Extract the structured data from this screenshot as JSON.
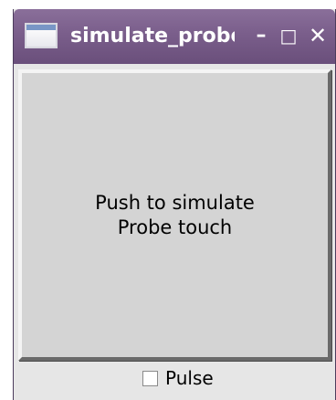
{
  "window": {
    "title": "simulate_probe",
    "controls": {
      "minimize": "–",
      "maximize": "□",
      "close": "✕"
    }
  },
  "main_button": {
    "label": "Push to simulate\nProbe touch"
  },
  "pulse_checkbox": {
    "label": "Pulse",
    "checked": false
  },
  "colors": {
    "titlebar": "#7a5e8b",
    "window_bg": "#e6e6e6",
    "button_face": "#d4d4d4"
  }
}
